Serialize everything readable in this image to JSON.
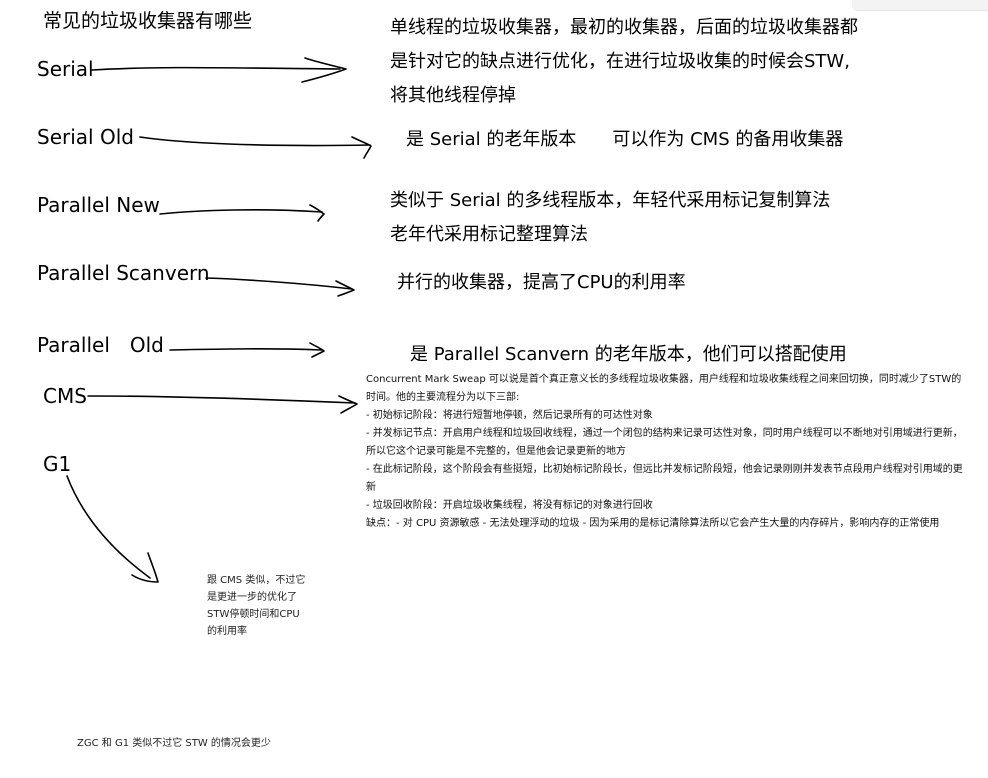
{
  "title": "常见的垃圾收集器有哪些",
  "collectors": [
    {
      "name": "Serial",
      "desc": [
        "单线程的垃圾收集器，最初的收集器，后面的垃圾收集器都",
        "是针对它的缺点进行优化，在进行垃圾收集的时候会STW,",
        "将其他线程停掉"
      ]
    },
    {
      "name": "Serial Old",
      "desc": [
        "是 Serial 的老年版本　　可以作为 CMS 的备用收集器"
      ]
    },
    {
      "name": "Parallel New",
      "desc": [
        "类似于 Serial 的多线程版本，年轻代采用标记复制算法",
        "老年代采用标记整理算法"
      ]
    },
    {
      "name": "Parallel Scanvern",
      "desc": [
        "并行的收集器，提高了CPU的利用率"
      ]
    },
    {
      "name": "Parallel　Old",
      "desc": [
        "是 Parallel Scanvern 的老年版本，他们可以搭配使用"
      ]
    },
    {
      "name": "CMS",
      "desc": []
    },
    {
      "name": "G1",
      "desc": []
    }
  ],
  "cms_detail": [
    "Concurrent Mark Sweap 可以说是首个真正意义长的多线程垃圾收集器，用户线程和垃圾收集线程之间来回切换，同时减少了STW的",
    "时间。他的主要流程分为以下三部:",
    "- 初始标记阶段：将进行短暂地停顿，然后记录所有的可达性对象",
    "- 并发标记节点：开启用户线程和垃圾回收线程，通过一个闭包的结构来记录可达性对象，同时用户线程可以不断地对引用域进行更新，",
    "所以它这个记录可能是不完整的，但是他会记录更新的地方",
    "- 在此标记阶段，这个阶段会有些挺短，比初始标记阶段长，但远比并发标记阶段短，他会记录刚刚并发表节点段用户线程对引用域的更",
    "新",
    "- 垃圾回收阶段：开启垃圾收集线程，将没有标记的对象进行回收",
    "缺点：- 对 CPU 资源敏感 - 无法处理浮动的垃圾 - 因为采用的是标记清除算法所以它会产生大量的内存碎片，影响内存的正常使用"
  ],
  "g1_note": [
    "跟 CMS 类似，不过它",
    "是更进一步的优化了",
    "STW停顿时间和CPU",
    "的利用率"
  ],
  "footer_note": "ZGC 和 G1 类似不过它 STW 的情况会更少"
}
